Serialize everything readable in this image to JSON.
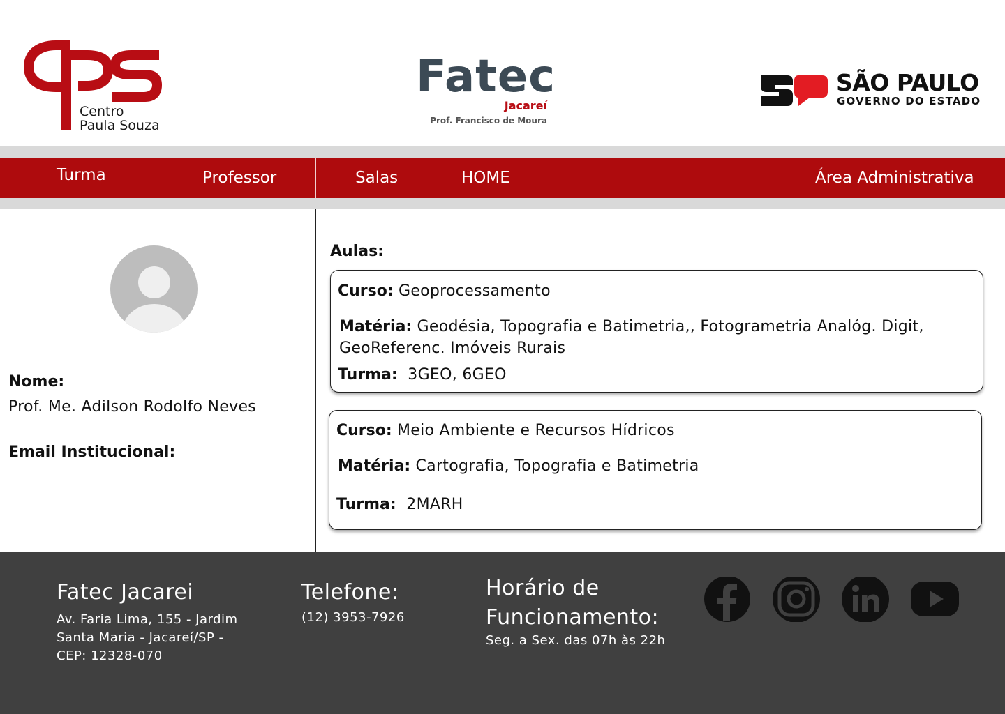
{
  "header": {
    "cps": {
      "line1": "Centro",
      "line2": "Paula Souza"
    },
    "fatec": {
      "title": "Fatec",
      "city": "Jacareí",
      "subtitle": "Prof. Francisco de Moura"
    },
    "sp": {
      "name": "SÃO PAULO",
      "subtitle": "GOVERNO DO ESTADO"
    }
  },
  "nav": {
    "items": [
      "Turma",
      "Professor",
      "Salas",
      "HOME"
    ],
    "admin": "Área Administrativa"
  },
  "profile": {
    "name_label": "Nome:",
    "name_value": "Prof. Me. Adilson Rodolfo Neves",
    "email_label": "Email Institucional:"
  },
  "aulas": {
    "title": "Aulas:",
    "cards": [
      {
        "curso_label": "Curso:",
        "curso": "Geoprocessamento",
        "materia_label": "Matéria:",
        "materia_line1": "Geodésia, Topografia e Batimetria,, Fotogrametria Analóg. Digit,",
        "materia_line2": "GeoReferenc. Imóveis Rurais",
        "turma_label": "Turma:",
        "turma": "3GEO, 6GEO"
      },
      {
        "curso_label": "Curso:",
        "curso": "Meio Ambiente e Recursos Hídricos",
        "materia_label": "Matéria:",
        "materia_line1": "Cartografia, Topografia e Batimetria",
        "turma_label": "Turma:",
        "turma": "2MARH"
      }
    ]
  },
  "footer": {
    "title": "Fatec Jacarei",
    "address": [
      "Av. Faria Lima, 155 - Jardim",
      "Santa Maria - Jacareí/SP -",
      "CEP: 12328-070"
    ],
    "phone_title": "Telefone:",
    "phone": "(12) 3953-7926",
    "hours_title_line1": "Horário de",
    "hours_title_line2": "Funcionamento:",
    "hours": "Seg. a Sex. das 07h às 22h",
    "social": [
      "facebook-icon",
      "instagram-icon",
      "linkedin-icon",
      "youtube-icon"
    ]
  },
  "colors": {
    "brand_red": "#ae0b0d",
    "nav_gray": "#d9d9d9",
    "footer_bg": "#404040",
    "fatec_gray": "#3c4a55"
  }
}
